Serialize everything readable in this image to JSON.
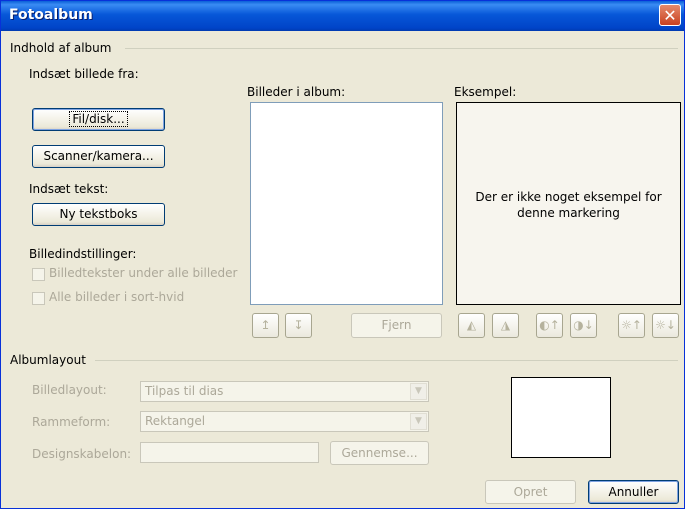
{
  "window": {
    "title": "Fotoalbum",
    "close_glyph": "✕"
  },
  "content_group": {
    "label": "Indhold af album"
  },
  "insert_picture": {
    "label": "Indsæt billede fra:",
    "file_button": "Fil/disk...",
    "scanner_button": "Scanner/kamera..."
  },
  "insert_text": {
    "label": "Indsæt tekst:",
    "new_textbox_button": "Ny tekstboks"
  },
  "picture_options": {
    "label": "Billedindstillinger:",
    "captions": {
      "label": "Billedtekster under alle billeder",
      "checked": false,
      "enabled": false
    },
    "black_white": {
      "label": "Alle billeder i sort-hvid",
      "checked": false,
      "enabled": false
    }
  },
  "album_list": {
    "label": "Billeder i album:",
    "items": []
  },
  "preview": {
    "label": "Eksempel:",
    "message": "Der er ikke noget eksempel for denne markering"
  },
  "buttons": {
    "move_up": "↥",
    "move_down": "↧",
    "remove": "Fjern",
    "rotate_left": "◭",
    "rotate_right": "◮",
    "contrast_up": "◐↑",
    "contrast_down": "◑↓",
    "brightness_up": "☼↑",
    "brightness_down": "☼↓"
  },
  "album_layout": {
    "label": "Albumlayout",
    "picture_layout": {
      "label": "Billedlayout:",
      "value": "Tilpas til dias"
    },
    "frame_shape": {
      "label": "Rammeform:",
      "value": "Rektangel"
    },
    "design_template": {
      "label": "Designskabelon:",
      "value": "",
      "browse_button": "Gennemse..."
    }
  },
  "footer": {
    "create_button": "Opret",
    "cancel_button": "Annuller"
  }
}
